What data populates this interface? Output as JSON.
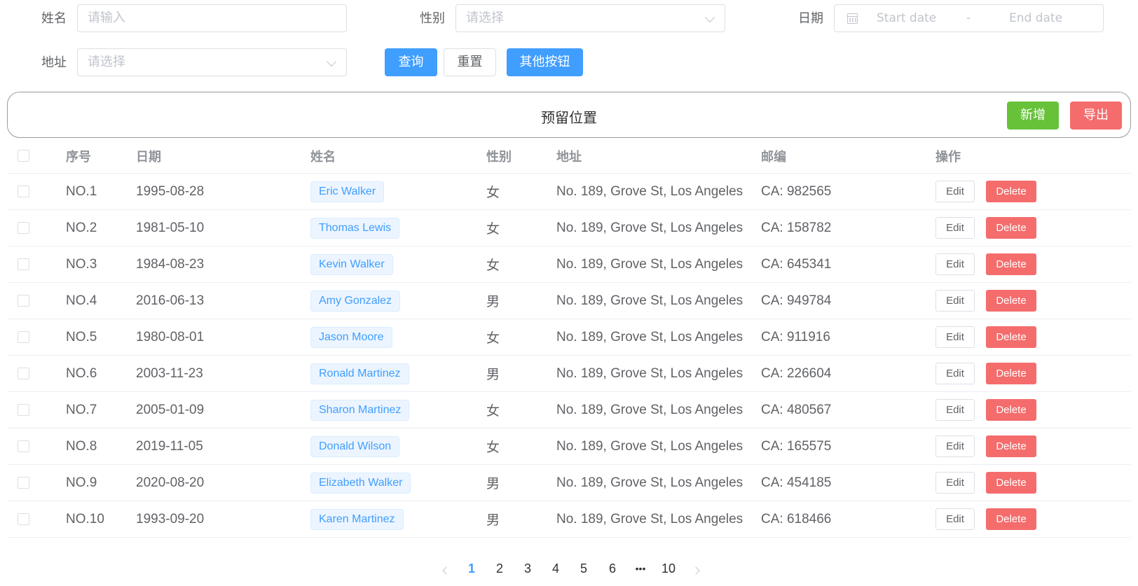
{
  "search": {
    "name_label": "姓名",
    "name_placeholder": "请输入",
    "gender_label": "性别",
    "gender_placeholder": "请选择",
    "date_label": "日期",
    "date_start_placeholder": "Start date",
    "date_separator": "-",
    "date_end_placeholder": "End date",
    "address_label": "地址",
    "address_placeholder": "请选择",
    "query_button": "查询",
    "reset_button": "重置",
    "other_button": "其他按钮"
  },
  "toolbar": {
    "title": "预留位置",
    "add_button": "新增",
    "export_button": "导出"
  },
  "table": {
    "headers": [
      "序号",
      "日期",
      "姓名",
      "性别",
      "地址",
      "邮编",
      "操作"
    ],
    "edit_label": "Edit",
    "delete_label": "Delete",
    "rows": [
      {
        "no": "NO.1",
        "date": "1995-08-28",
        "name": "Eric Walker",
        "gender": "女",
        "address": "No. 189, Grove St, Los Angeles",
        "zip": "CA: 982565"
      },
      {
        "no": "NO.2",
        "date": "1981-05-10",
        "name": "Thomas Lewis",
        "gender": "女",
        "address": "No. 189, Grove St, Los Angeles",
        "zip": "CA: 158782"
      },
      {
        "no": "NO.3",
        "date": "1984-08-23",
        "name": "Kevin Walker",
        "gender": "女",
        "address": "No. 189, Grove St, Los Angeles",
        "zip": "CA: 645341"
      },
      {
        "no": "NO.4",
        "date": "2016-06-13",
        "name": "Amy Gonzalez",
        "gender": "男",
        "address": "No. 189, Grove St, Los Angeles",
        "zip": "CA: 949784"
      },
      {
        "no": "NO.5",
        "date": "1980-08-01",
        "name": "Jason Moore",
        "gender": "女",
        "address": "No. 189, Grove St, Los Angeles",
        "zip": "CA: 911916"
      },
      {
        "no": "NO.6",
        "date": "2003-11-23",
        "name": "Ronald Martinez",
        "gender": "男",
        "address": "No. 189, Grove St, Los Angeles",
        "zip": "CA: 226604"
      },
      {
        "no": "NO.7",
        "date": "2005-01-09",
        "name": "Sharon Martinez",
        "gender": "女",
        "address": "No. 189, Grove St, Los Angeles",
        "zip": "CA: 480567"
      },
      {
        "no": "NO.8",
        "date": "2019-11-05",
        "name": "Donald Wilson",
        "gender": "女",
        "address": "No. 189, Grove St, Los Angeles",
        "zip": "CA: 165575"
      },
      {
        "no": "NO.9",
        "date": "2020-08-20",
        "name": "Elizabeth Walker",
        "gender": "男",
        "address": "No. 189, Grove St, Los Angeles",
        "zip": "CA: 454185"
      },
      {
        "no": "NO.10",
        "date": "1993-09-20",
        "name": "Karen Martinez",
        "gender": "男",
        "address": "No. 189, Grove St, Los Angeles",
        "zip": "CA: 618466"
      }
    ]
  },
  "pagination": {
    "pages": [
      "1",
      "2",
      "3",
      "4",
      "5",
      "6",
      "•••",
      "10"
    ],
    "current": "1"
  },
  "colors": {
    "primary": "#409eff",
    "success": "#67c23a",
    "danger": "#f56c6c"
  }
}
